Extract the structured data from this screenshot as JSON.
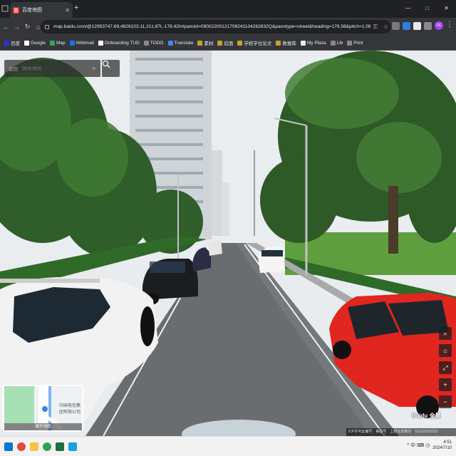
{
  "browser": {
    "tab": {
      "title": "百度地图",
      "favicon_text": "百"
    },
    "new_tab": "+",
    "window_controls": [
      "—",
      "□",
      "✕"
    ],
    "nav": {
      "back": "←",
      "forward": "→",
      "reload": "↻",
      "home": "⌂"
    },
    "url": "map.baidu.com/@12953747.69,4826103.11,21z,87t,-178.42h#panoid=09002200121706241104262832Q&panotype=street&heading=178.58&pitch=1.08&l=21&tn=B_NORMAL...",
    "url_icons": [
      "key-icon",
      "star-icon"
    ],
    "extensions": [
      {
        "name": "extension-1",
        "color": "#7a7a7a"
      },
      {
        "name": "extension-2",
        "color": "#2f7be5"
      },
      {
        "name": "extension-3",
        "color": "#e8eaed"
      },
      {
        "name": "extension-4",
        "color": "#888888"
      }
    ],
    "profile": "FE",
    "menu": "⋮"
  },
  "bookmarks": [
    {
      "label": "百度",
      "color": "#2932e1"
    },
    {
      "label": "Google",
      "color": "#ffffff"
    },
    {
      "label": "Map",
      "color": "#34a853"
    },
    {
      "label": "Webmail",
      "color": "#1a73e8"
    },
    {
      "label": "Onboarding TUD",
      "color": "#ffffff"
    },
    {
      "label": "TODO",
      "color": "#888888"
    },
    {
      "label": "Translate",
      "color": "#4285f4"
    },
    {
      "label": "素材",
      "color": "#c9a227"
    },
    {
      "label": "后面",
      "color": "#c9a227"
    },
    {
      "label": "学校学位论文",
      "color": "#c9a227"
    },
    {
      "label": "数据库",
      "color": "#c9a227"
    },
    {
      "label": "My Plaza",
      "color": "#e8eaed"
    },
    {
      "label": "Lib",
      "color": "#888888"
    },
    {
      "label": "Print",
      "color": "#888888"
    }
  ],
  "map": {
    "search": {
      "back_label": "返回",
      "placeholder": "搜索地址",
      "clear": "✕"
    },
    "minimap": {
      "place_label": "中国电信集团有限公司",
      "caption": "展开地图"
    },
    "right_controls": [
      "⌕",
      "⌂",
      "⤢",
      "+",
      "−"
    ],
    "logo": "Baidu 全景",
    "copyright": [
      "ICP许可证编号",
      "审图号",
      "上报全景路径",
      "GS(2020)5231"
    ]
  },
  "taskbar": {
    "apps": [
      {
        "name": "windows-start-icon",
        "color": "#0078d4"
      },
      {
        "name": "chrome-icon",
        "color": "#e8453c"
      },
      {
        "name": "file-explorer-icon",
        "color": "#f6c445"
      },
      {
        "name": "edge-icon",
        "color": "#2ea44f"
      },
      {
        "name": "excel-icon",
        "color": "#1d6f42"
      },
      {
        "name": "qq-icon",
        "color": "#1aa1e1"
      }
    ],
    "tray_text": "^ 中 ⌨ ◷",
    "time": "4:51",
    "date": "2024/7/10"
  }
}
